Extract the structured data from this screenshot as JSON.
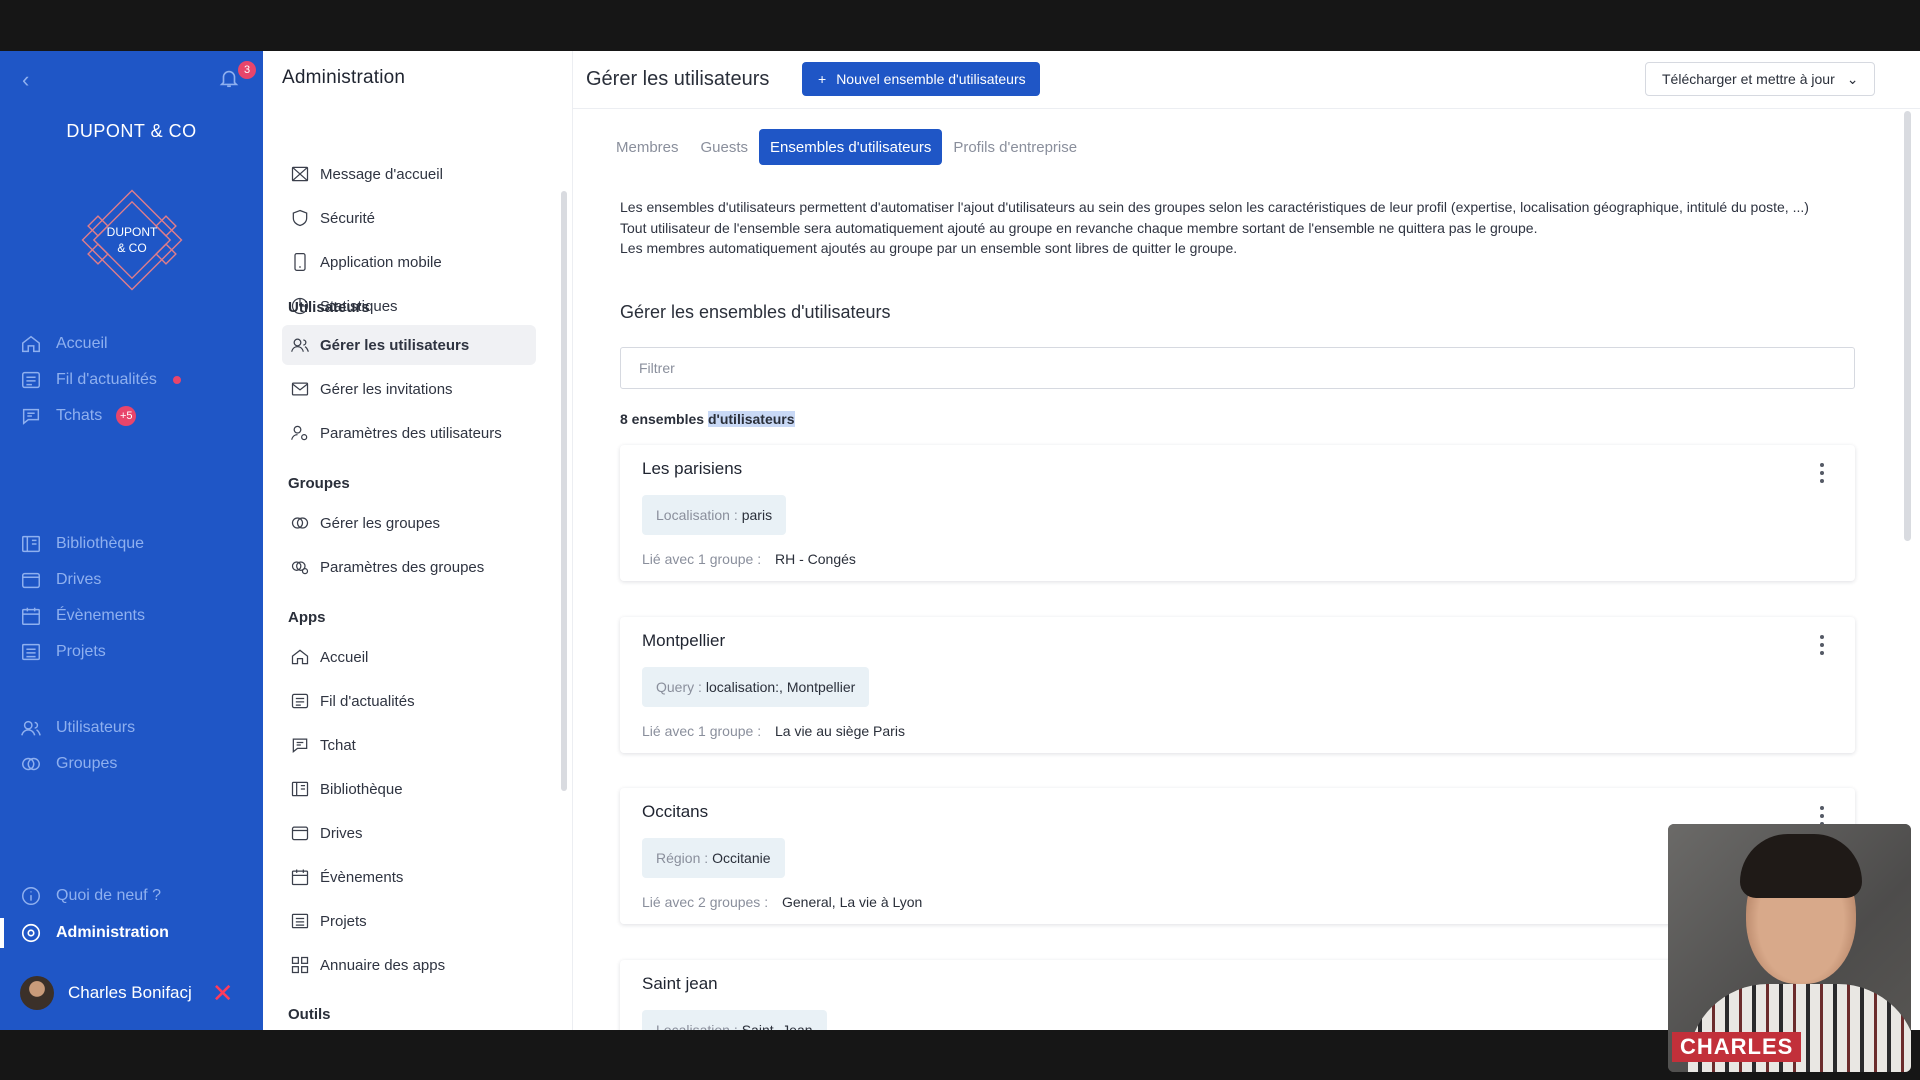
{
  "sidebar": {
    "notif_count": "3",
    "brand": "DUPONT & CO",
    "logo_text": [
      "DUPONT",
      "& CO"
    ],
    "items": [
      {
        "label": "Accueil",
        "icon": "home-icon"
      },
      {
        "label": "Fil d'actualités",
        "icon": "news-icon"
      },
      {
        "label": "Tchats",
        "icon": "chat-icon",
        "badge": "+5"
      },
      {
        "label": "Bibliothèque",
        "icon": "library-icon"
      },
      {
        "label": "Drives",
        "icon": "drive-icon"
      },
      {
        "label": "Évènements",
        "icon": "calendar-icon"
      },
      {
        "label": "Projets",
        "icon": "projects-icon"
      },
      {
        "label": "Utilisateurs",
        "icon": "users-icon"
      },
      {
        "label": "Groupes",
        "icon": "groups-icon"
      },
      {
        "label": "Quoi de neuf ?",
        "icon": "info-icon"
      },
      {
        "label": "Administration",
        "icon": "settings-icon"
      }
    ],
    "user_name": "Charles Bonifacj",
    "accent": "#1f56c6",
    "badge_color": "#e8456b"
  },
  "admin": {
    "title": "Administration",
    "general": [
      {
        "label": "Message d'accueil",
        "icon": "welcome-icon"
      },
      {
        "label": "Sécurité",
        "icon": "shield-icon"
      },
      {
        "label": "Application mobile",
        "icon": "mobile-icon"
      },
      {
        "label": "Statistiques",
        "icon": "stats-icon"
      }
    ],
    "users_section": "Utilisateurs",
    "users": [
      {
        "label": "Gérer les utilisateurs",
        "icon": "users-icon"
      },
      {
        "label": "Gérer les invitations",
        "icon": "mail-icon"
      },
      {
        "label": "Paramètres des utilisateurs",
        "icon": "user-settings-icon"
      }
    ],
    "groups_section": "Groupes",
    "groups": [
      {
        "label": "Gérer les groupes",
        "icon": "groups-icon"
      },
      {
        "label": "Paramètres des groupes",
        "icon": "group-settings-icon"
      }
    ],
    "apps_section": "Apps",
    "apps": [
      {
        "label": "Accueil",
        "icon": "home-icon"
      },
      {
        "label": "Fil d'actualités",
        "icon": "news-icon"
      },
      {
        "label": "Tchat",
        "icon": "chat-icon"
      },
      {
        "label": "Bibliothèque",
        "icon": "library-icon"
      },
      {
        "label": "Drives",
        "icon": "drive-icon"
      },
      {
        "label": "Évènements",
        "icon": "calendar-icon"
      },
      {
        "label": "Projets",
        "icon": "projects-icon"
      },
      {
        "label": "Annuaire des apps",
        "icon": "apps-grid-icon"
      }
    ],
    "tools_section": "Outils"
  },
  "main": {
    "title": "Gérer les utilisateurs",
    "new_button": "Nouvel ensemble d'utilisateurs",
    "download_button": "Télécharger et mettre à jour",
    "tabs": [
      "Membres",
      "Guests",
      "Ensembles d'utilisateurs",
      "Profils d'entreprise"
    ],
    "intro": [
      "Les ensembles d'utilisateurs permettent d'automatiser l'ajout d'utilisateurs au sein des groupes selon les caractéristiques de leur profil (expertise, localisation géographique, intitulé du poste, ...)",
      "Tout utilisateur de l'ensemble sera automatiquement ajouté au groupe en revanche chaque membre sortant de l'ensemble ne quittera pas le groupe.",
      "Les membres automatiquement ajoutés au groupe par un ensemble sont libres de quitter le groupe."
    ],
    "section_title": "Gérer les ensembles d'utilisateurs",
    "filter_placeholder": "Filtrer",
    "count_prefix": "8 ensembles",
    "count_suffix": "d'utilisateurs",
    "cards": [
      {
        "name": "Les parisiens",
        "chip_key": "Localisation :",
        "chip_value": "paris",
        "link_label": "Lié avec 1 groupe :",
        "link_value": "RH - Congés"
      },
      {
        "name": "Montpellier",
        "chip_key": "Query :",
        "chip_value": "localisation:, Montpellier",
        "link_label": "Lié avec 1 groupe :",
        "link_value": "La vie au siège Paris"
      },
      {
        "name": "Occitans",
        "chip_key": "Région :",
        "chip_value": "Occitanie",
        "link_label": "Lié avec 2 groupes :",
        "link_value": "General, La vie à Lyon"
      },
      {
        "name": "Saint jean",
        "chip_key": "Localisation :",
        "chip_value": "Saint- Jean",
        "link_label": "",
        "link_value": ""
      }
    ]
  },
  "webcam": {
    "label": "CHARLES"
  }
}
